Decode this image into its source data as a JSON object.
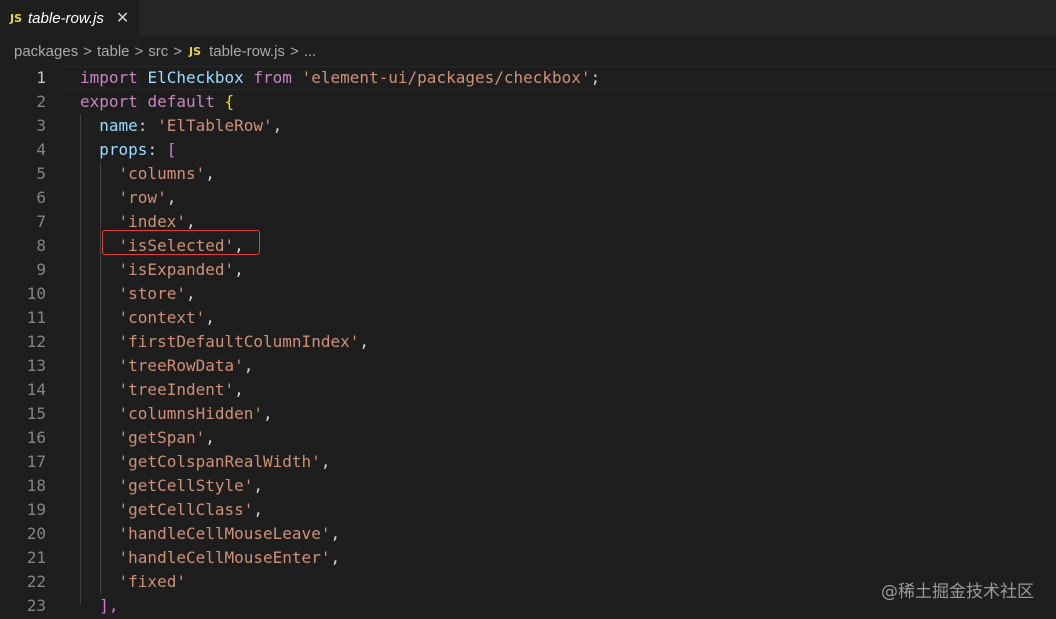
{
  "tab": {
    "icon": "JS",
    "label": "table-row.js",
    "close": "✕"
  },
  "breadcrumb": {
    "items": [
      "packages",
      "table",
      "src"
    ],
    "file_icon": "JS",
    "file": "table-row.js",
    "more": "...",
    "separator": ">"
  },
  "editor": {
    "line_numbers": [
      "1",
      "2",
      "3",
      "4",
      "5",
      "6",
      "7",
      "8",
      "9",
      "10",
      "11",
      "12",
      "13",
      "14",
      "15",
      "16",
      "17",
      "18",
      "19",
      "20",
      "21",
      "22",
      "23"
    ],
    "line1": {
      "kw": "import",
      "id": "ElCheckbox",
      "from": "from",
      "str": "'element-ui/packages/checkbox'",
      "end": ";"
    },
    "line2": {
      "kw1": "export",
      "kw2": "default",
      "brace": "{"
    },
    "line3": {
      "key": "name",
      "colon": ":",
      "str": "'ElTableRow'",
      "end": ","
    },
    "line4": {
      "key": "props",
      "colon": ":",
      "bracket": "["
    },
    "props": [
      "'columns'",
      "'row'",
      "'index'",
      "'isSelected'",
      "'isExpanded'",
      "'store'",
      "'context'",
      "'firstDefaultColumnIndex'",
      "'treeRowData'",
      "'treeIndent'",
      "'columnsHidden'",
      "'getSpan'",
      "'getColspanRealWidth'",
      "'getCellStyle'",
      "'getCellClass'",
      "'handleCellMouseLeave'",
      "'handleCellMouseEnter'",
      "'fixed'"
    ],
    "comma": ",",
    "line23": "],"
  },
  "watermark": "@稀土掘金技术社区"
}
